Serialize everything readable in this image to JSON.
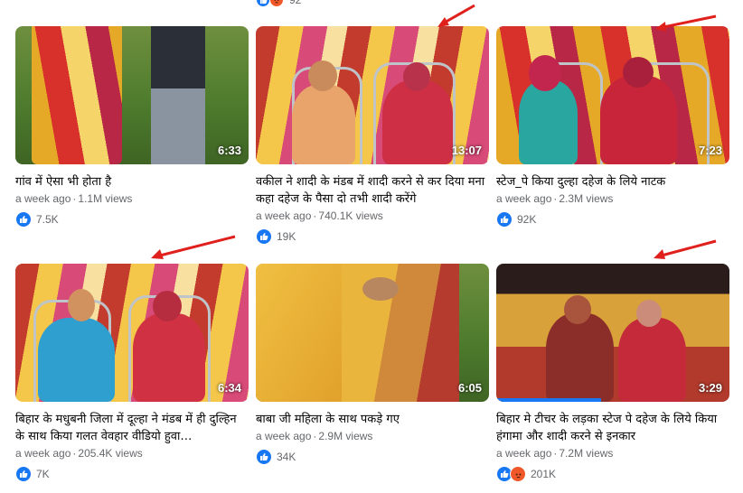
{
  "top_strip": {
    "count": "92"
  },
  "videos": [
    {
      "title": "गांव में ऐसा भी होता है",
      "age": "a week ago",
      "views": "1.1M views",
      "duration": "6:33",
      "reactions": [
        "like"
      ],
      "reaction_count": "7.5K"
    },
    {
      "title": "वकील ने शादी के मंडब में शादी करने से कर दिया मना कहा दहेज के पैसा दो तभी शादी करेंगे",
      "age": "a week ago",
      "views": "740.1K views",
      "duration": "13:07",
      "reactions": [
        "like"
      ],
      "reaction_count": "19K"
    },
    {
      "title": "स्टेज_पे किया दुल्हा दहेज के लिये नाटक",
      "age": "a week ago",
      "views": "2.3M views",
      "duration": "7:23",
      "reactions": [
        "like"
      ],
      "reaction_count": "92K"
    },
    {
      "title": "बिहार के मधुबनी जिला में दूल्हा ने मंडब में ही दुल्हिन के साथ किया गलत वेवहार वीडियो हुवा…",
      "age": "a week ago",
      "views": "205.4K views",
      "duration": "6:34",
      "reactions": [
        "like"
      ],
      "reaction_count": "7K"
    },
    {
      "title": "बाबा जी महिला के साथ पकड़े गए",
      "age": "a week ago",
      "views": "2.9M views",
      "duration": "6:05",
      "reactions": [
        "like"
      ],
      "reaction_count": "34K"
    },
    {
      "title": "बिहार मे टीचर के लड़का स्टेज पे दहेज के लिये किया हंगामा और शादी करने से इनकार",
      "age": "a week ago",
      "views": "7.2M views",
      "duration": "3:29",
      "reactions": [
        "like",
        "angry"
      ],
      "reaction_count": "201K",
      "progress": 0.45
    }
  ],
  "colors": {
    "like": "#1877f2",
    "angry": "#f0582a",
    "arrow": "#e0201c"
  }
}
